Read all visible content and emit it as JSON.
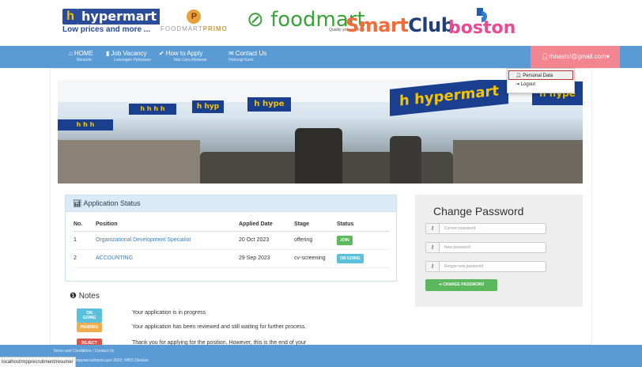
{
  "logos": {
    "hypermart_name": "hypermart",
    "hypermart_tagline": "Low prices and more ...",
    "foodmart_primo_a": "FOODMART",
    "foodmart_primo_b": "PRIMO",
    "foodmart_name": "foodmart",
    "foodmart_tagline": "Quality you can trust",
    "smartclub_a": "Smart",
    "smartclub_b": "Club",
    "boston_name": "boston"
  },
  "nav": {
    "items": [
      {
        "label": "HOME",
        "sub": "Beranda",
        "icon": "home-icon"
      },
      {
        "label": "Job Vacancy",
        "sub": "Lowongan Pekerjaan",
        "icon": "bookmark-icon"
      },
      {
        "label": "How to Apply",
        "sub": "Tata Cara Melamar",
        "icon": "check-icon"
      },
      {
        "label": "Contact Us",
        "sub": "Hubungi Kami",
        "icon": "envelope-icon"
      }
    ],
    "user_email": "rhnashil@gmail.com",
    "user_menu": [
      {
        "label": "Personal Data",
        "icon": "user-icon"
      },
      {
        "label": "Logout",
        "icon": "logout-icon"
      }
    ]
  },
  "application_status": {
    "title": "Application Status",
    "columns": [
      "No.",
      "Position",
      "Applied Date",
      "Stage",
      "Status"
    ],
    "rows": [
      {
        "no": "1",
        "position": "Organizational Development Specialist",
        "applied_date": "20 Oct 2023",
        "stage": "offering",
        "status": "JOIN"
      },
      {
        "no": "2",
        "position": "ACCOUNTING",
        "applied_date": "29 Sep 2023",
        "stage": "cv-screening",
        "status": "ON GOING"
      }
    ]
  },
  "notes": {
    "title": "Notes",
    "items": [
      {
        "badge": "ON GOING",
        "text": "Your application is in progress"
      },
      {
        "badge": "PENDING",
        "text": "Your application has been reviewed and still waiting for further process."
      },
      {
        "badge": "REJECT",
        "text": "Thank you for applying for the position. However, this is the end of your"
      }
    ]
  },
  "change_password": {
    "title": "Change Password",
    "current_placeholder": "Current password",
    "new_placeholder": "New password",
    "retype_placeholder": "Retype new password",
    "button": "CHANGE PASSWORD"
  },
  "footer": {
    "links": "Terms and Conditions  /  Contact Us",
    "copyright": "mpprecruitment.com 2023, HRIS Division"
  },
  "status_bar": "localhost/mpprecruitment/resume/",
  "colors": {
    "nav": "#5b9bd5",
    "user_menu": "#f2858f",
    "join": "#5cb85c",
    "ongoing": "#5bc0de",
    "pending": "#f0ad4e",
    "reject": "#d9534f"
  }
}
